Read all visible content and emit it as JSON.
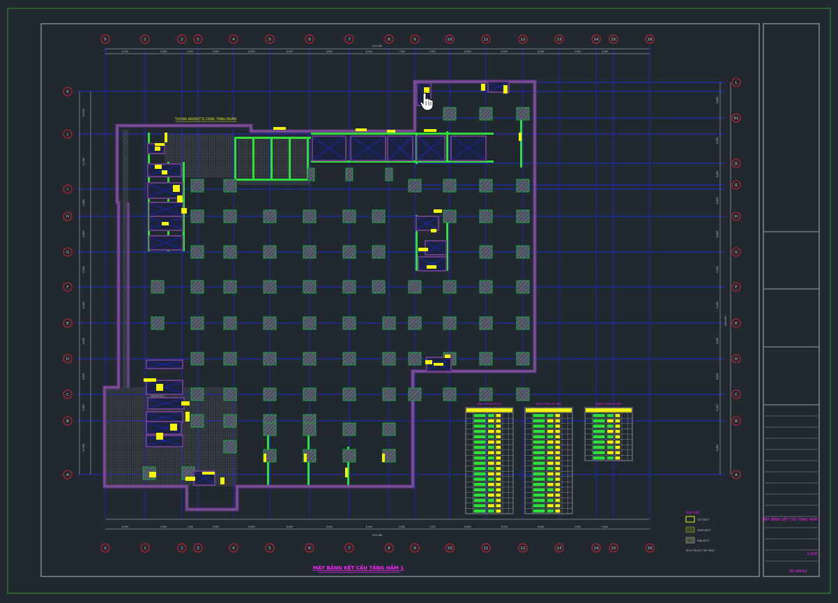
{
  "colors": {
    "background": "#212830",
    "sheet_border": "#2e9e2e",
    "frame": "#7f8790",
    "grid": "#1a2cff",
    "bubble": "#e0202a",
    "wall": "#6a3e86",
    "column": "#1aa83a",
    "beam": "#2fe03a",
    "rebar": "#f4f40a",
    "accent": "#ff20ff",
    "dims": "#c8ccd2"
  },
  "grid_x_labels": [
    "0",
    "1",
    "2",
    "3",
    "4",
    "5",
    "6",
    "7",
    "8",
    "9",
    "10",
    "11",
    "12",
    "13",
    "14",
    "15",
    "16"
  ],
  "grid_y_labels": [
    "K",
    "J",
    "I",
    "H",
    "G",
    "F",
    "E",
    "D",
    "C",
    "B",
    "A"
  ],
  "grid_y_labels_right": [
    "L",
    "K1",
    "J1",
    "I1",
    "H",
    "G",
    "F",
    "E",
    "D",
    "C",
    "B",
    "A"
  ],
  "dim_top_total": "122,180",
  "dim_bottom_total": "122,180",
  "dim_right_total": "102,600",
  "dims_top": [
    "8,350",
    "5,000",
    "1,550",
    "5,950",
    "8,000",
    "8,000",
    "8,000",
    "8,000",
    "7,500",
    "7,500",
    "8,000",
    "8,000",
    "8,000",
    "3,950",
    "5,000"
  ],
  "dims_bottom": [
    "8,350",
    "5,000",
    "1,550",
    "5,950",
    "8,000",
    "8,000",
    "8,000",
    "8,000",
    "5,550",
    "7,500",
    "8,000",
    "8,000",
    "8,000",
    "3,950",
    "5,000"
  ],
  "dims_left": [
    "10,350",
    "12,300",
    "8,000",
    "8,000",
    "8,000",
    "8,000",
    "8,000",
    "8,000",
    "5,000",
    "12,300"
  ],
  "annotation_top": "TƯỜNG BARRETTE CÔNG TRÌNH NGẦM",
  "drawing_title": "MẶT BẰNG KẾT CẤU TẦNG HẦM 1",
  "legend": {
    "title": "GHI CHÚ",
    "items": [
      "CỘT BTCT",
      "VÁCH BTCT",
      "SÀN BTCT",
      "KÍCH THƯỚC TIM TRỤC"
    ]
  },
  "tables": [
    {
      "title": "BẢNG THỐNG KÊ CỘT"
    },
    {
      "title": "BẢNG THỐNG KÊ VÁCH"
    },
    {
      "title": "BẢNG THỐNG KÊ DẦM"
    }
  ],
  "title_block": {
    "sheet_name": "MẶT BẰNG KẾT CẤU TẦNG HẦM 1",
    "scale": "1/200",
    "sheet_no": "KC-HM-01"
  }
}
